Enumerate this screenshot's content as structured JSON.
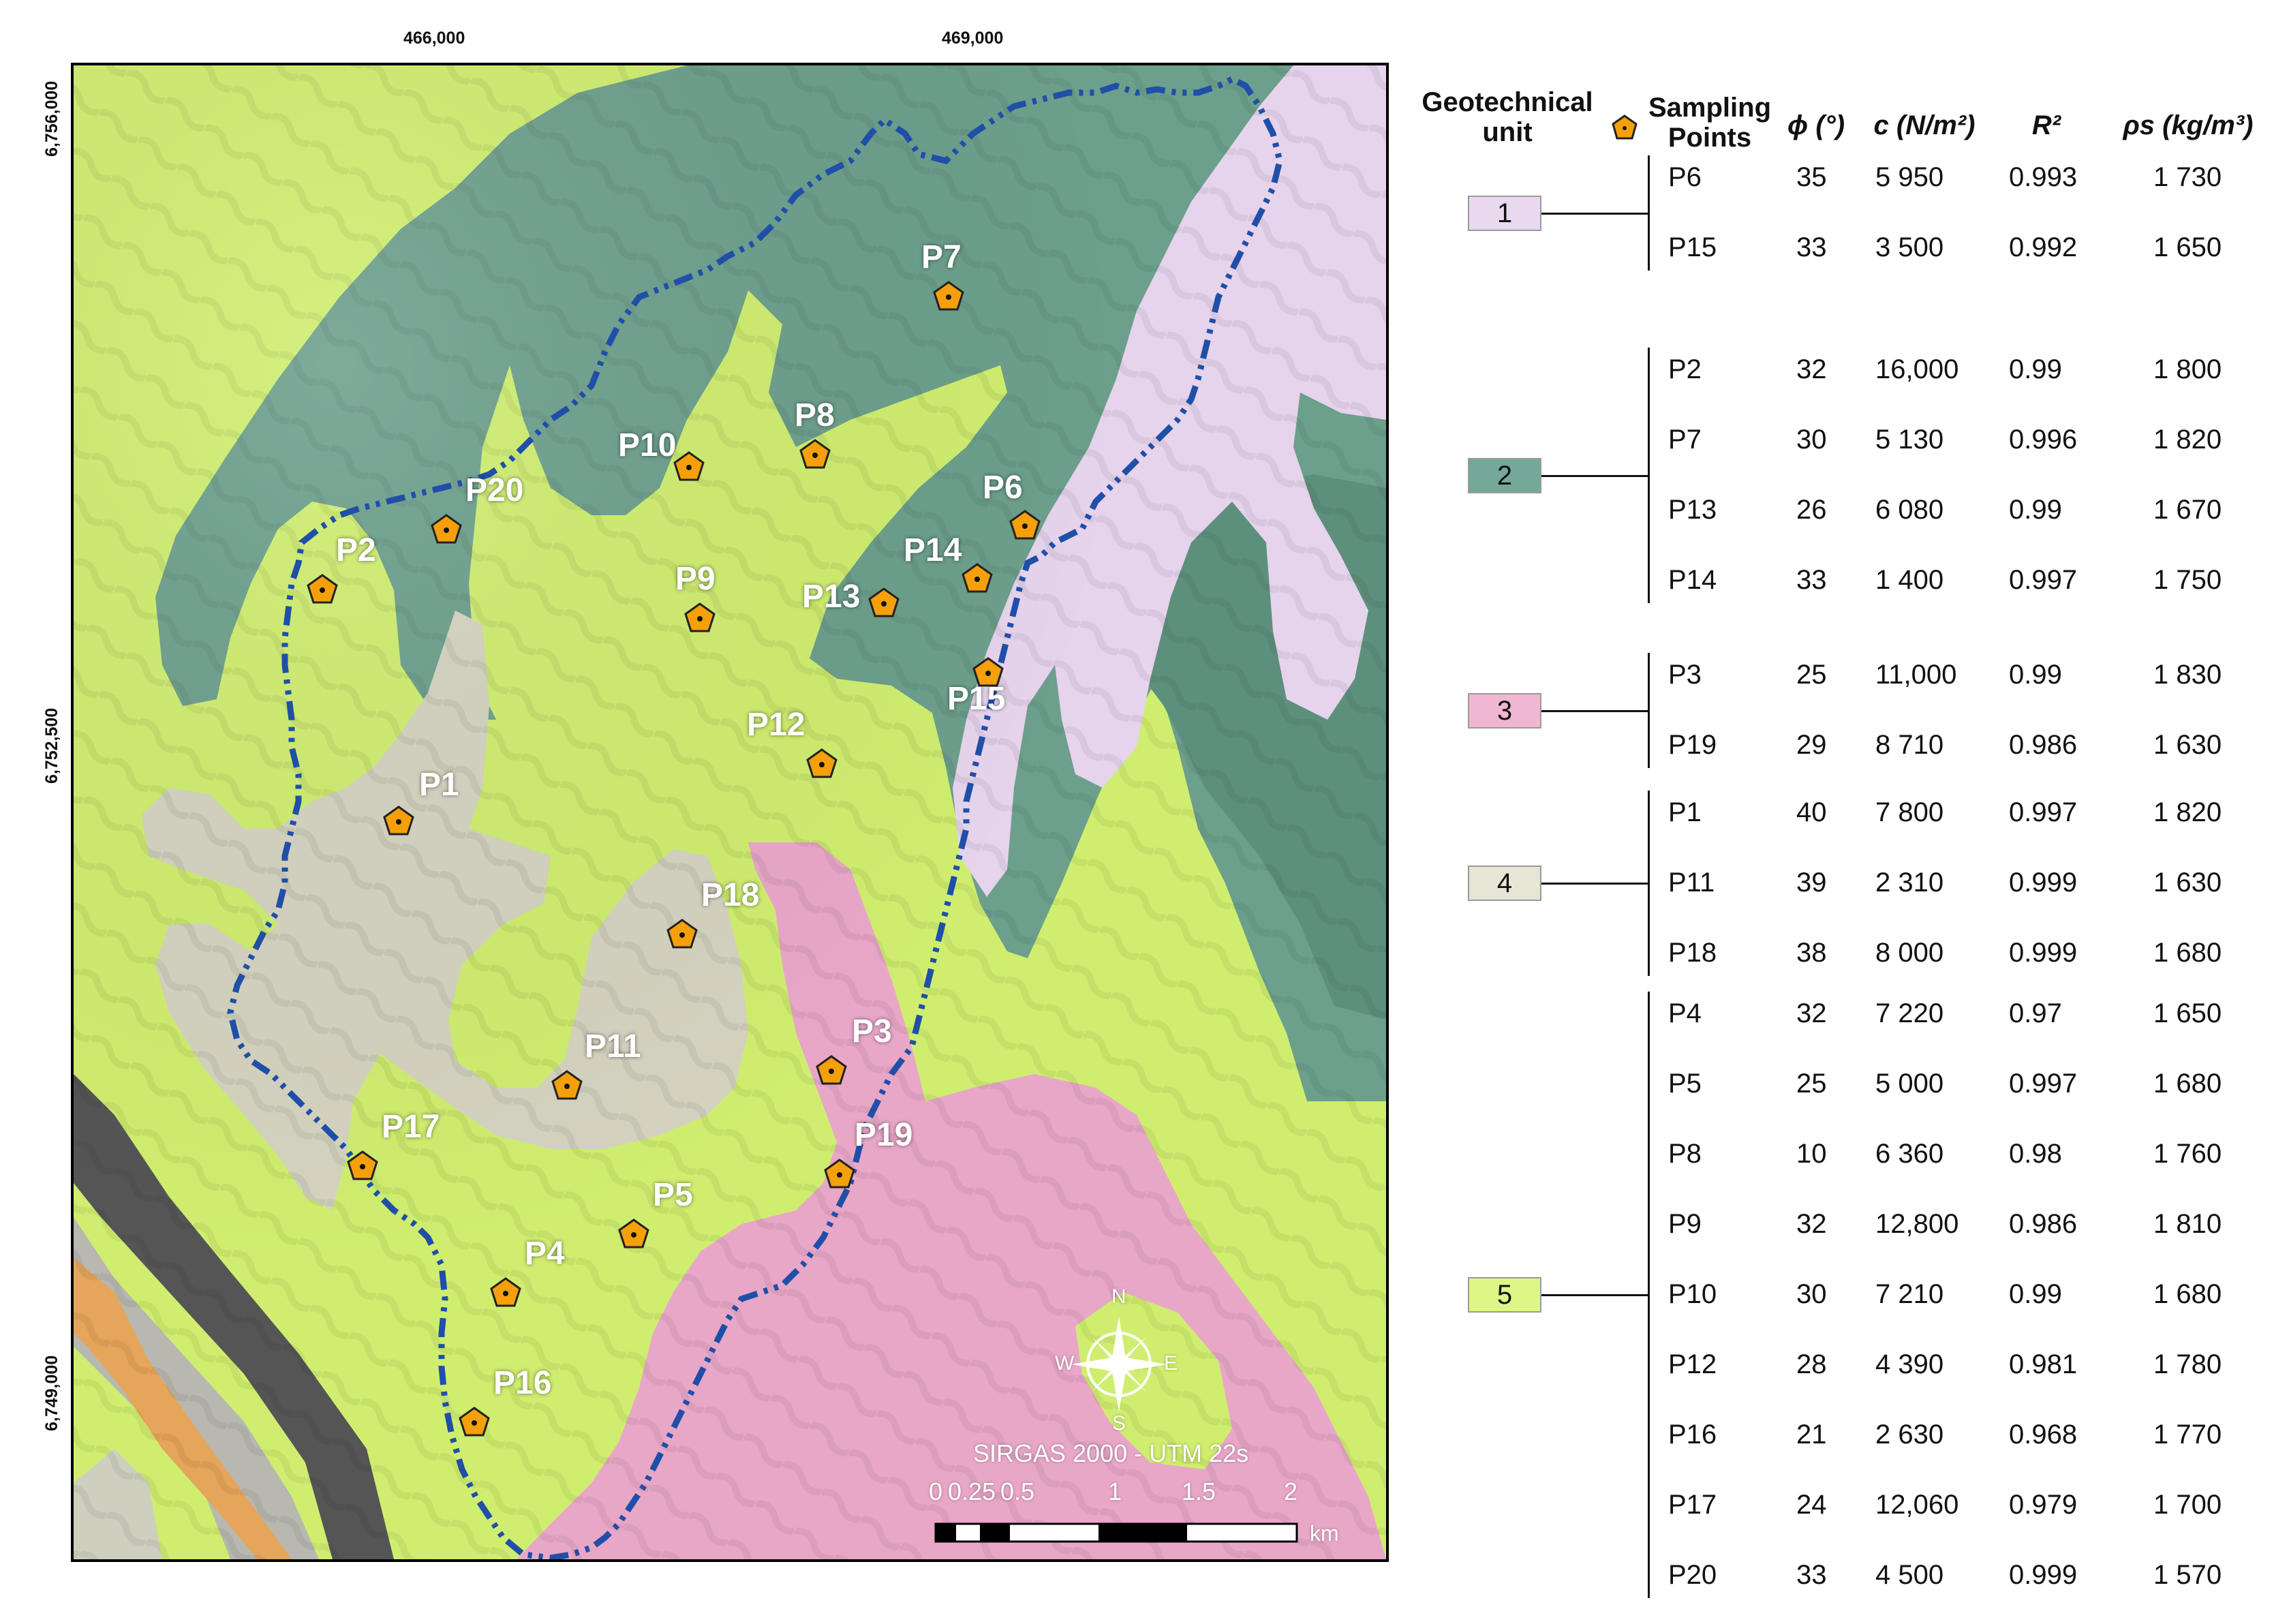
{
  "colors": {
    "unit1": "#e9d8ee",
    "unit2": "#74a898",
    "unit3": "#f0b6d2",
    "unit4": "#e6e6d6",
    "unit5": "#ddf786",
    "boundary": "#1f4fa8",
    "sampling_point": "#f5a00a"
  },
  "map": {
    "coordinates": {
      "x_ticks": [
        "466,000",
        "469,000"
      ],
      "y_ticks": [
        "6,756,000",
        "6,752,500",
        "6,749,000"
      ]
    },
    "crs": "SIRGAS 2000 - UTM 22s",
    "north_arrow": {
      "n": "N",
      "s": "S",
      "e": "E",
      "w": "W"
    },
    "scale_bar": {
      "labels": [
        "0",
        "0.25",
        "0.5",
        "1",
        "1.5",
        "2"
      ],
      "unit": "km"
    },
    "points": [
      "P1",
      "P2",
      "P3",
      "P4",
      "P5",
      "P6",
      "P7",
      "P8",
      "P9",
      "P10",
      "P11",
      "P12",
      "P13",
      "P14",
      "P15",
      "P16",
      "P17",
      "P18",
      "P19",
      "P20"
    ]
  },
  "legend": {
    "headers": {
      "unit": "Geotechnical unit",
      "sampling": "Sampling Points",
      "phi": "ϕ (°)",
      "c": "c (N/m²)",
      "r2": "R²",
      "rho": "ρs (kg/m³)"
    },
    "units": [
      {
        "label": "1",
        "rows": [
          {
            "point": "P6",
            "phi": "35",
            "c": "5 950",
            "r2": "0.993",
            "rho": "1 730"
          },
          {
            "point": "P15",
            "phi": "33",
            "c": "3 500",
            "r2": "0.992",
            "rho": "1 650"
          }
        ]
      },
      {
        "label": "2",
        "rows": [
          {
            "point": "P2",
            "phi": "32",
            "c": "16,000",
            "r2": "0.99",
            "rho": "1 800"
          },
          {
            "point": "P7",
            "phi": "30",
            "c": "5 130",
            "r2": "0.996",
            "rho": "1 820"
          },
          {
            "point": "P13",
            "phi": "26",
            "c": "6 080",
            "r2": "0.99",
            "rho": "1 670"
          },
          {
            "point": "P14",
            "phi": "33",
            "c": "1 400",
            "r2": "0.997",
            "rho": "1 750"
          }
        ]
      },
      {
        "label": "3",
        "rows": [
          {
            "point": "P3",
            "phi": "25",
            "c": "11,000",
            "r2": "0.99",
            "rho": "1 830"
          },
          {
            "point": "P19",
            "phi": "29",
            "c": "8 710",
            "r2": "0.986",
            "rho": "1 630"
          }
        ]
      },
      {
        "label": "4",
        "rows": [
          {
            "point": "P1",
            "phi": "40",
            "c": "7 800",
            "r2": "0.997",
            "rho": "1 820"
          },
          {
            "point": "P11",
            "phi": "39",
            "c": "2 310",
            "r2": "0.999",
            "rho": "1 630"
          },
          {
            "point": "P18",
            "phi": "38",
            "c": "8 000",
            "r2": "0.999",
            "rho": "1 680"
          }
        ]
      },
      {
        "label": "5",
        "rows": [
          {
            "point": "P4",
            "phi": "32",
            "c": "7 220",
            "r2": "0.97",
            "rho": "1 650"
          },
          {
            "point": "P5",
            "phi": "25",
            "c": "5 000",
            "r2": "0.997",
            "rho": "1 680"
          },
          {
            "point": "P8",
            "phi": "10",
            "c": "6 360",
            "r2": "0.98",
            "rho": "1 760"
          },
          {
            "point": "P9",
            "phi": "32",
            "c": "12,800",
            "r2": "0.986",
            "rho": "1 810"
          },
          {
            "point": "P10",
            "phi": "30",
            "c": "7 210",
            "r2": "0.99",
            "rho": "1 680"
          },
          {
            "point": "P12",
            "phi": "28",
            "c": "4 390",
            "r2": "0.981",
            "rho": "1 780"
          },
          {
            "point": "P16",
            "phi": "21",
            "c": "2 630",
            "r2": "0.968",
            "rho": "1 770"
          },
          {
            "point": "P17",
            "phi": "24",
            "c": "12,060",
            "r2": "0.979",
            "rho": "1 700"
          },
          {
            "point": "P20",
            "phi": "33",
            "c": "4 500",
            "r2": "0.999",
            "rho": "1 570"
          }
        ]
      }
    ]
  }
}
